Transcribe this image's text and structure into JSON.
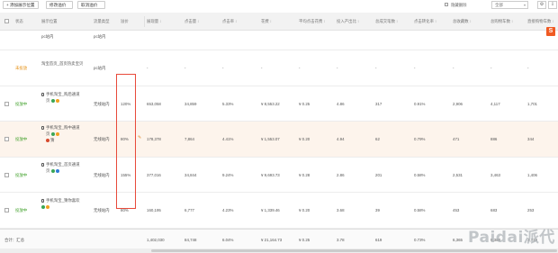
{
  "toolbar": {
    "add_label": "+ 添加展示位置",
    "bid_label": "修改溢价",
    "cancel_label": "取消溢价",
    "filter_label": "隐藏删除",
    "range_select": "全部",
    "gear_icon": "gear-icon",
    "download_icon": "download-icon"
  },
  "columns": [
    {
      "label": "状态",
      "sortable": false
    },
    {
      "label": "展示位置",
      "sortable": false
    },
    {
      "label": "流量类型",
      "sortable": false
    },
    {
      "label": "溢价",
      "sortable": false
    },
    {
      "label": "展现量",
      "sortable": true
    },
    {
      "label": "点击量",
      "sortable": true
    },
    {
      "label": "点击率",
      "sortable": true
    },
    {
      "label": "花费",
      "sortable": true
    },
    {
      "label": "平均点击花费",
      "sortable": true
    },
    {
      "label": "投入产出比",
      "sortable": true
    },
    {
      "label": "总成交笔数",
      "sortable": true
    },
    {
      "label": "点击转化率",
      "sortable": true
    },
    {
      "label": "总收藏数",
      "sortable": true
    },
    {
      "label": "总购物车数",
      "sortable": true
    },
    {
      "label": "直接购物车数",
      "sortable": true
    }
  ],
  "rows": [
    {
      "status": "",
      "position_lines": [
        "pc站内"
      ],
      "traffic": "pc站内",
      "premium": "",
      "metrics": [
        "",
        "",
        "",
        "",
        "",
        "",
        "",
        "",
        "",
        "",
        ""
      ]
    },
    {
      "status": "未投放",
      "position_lines": [
        "淘宝首页_首页热卖宝贝"
      ],
      "traffic": "pc站内",
      "premium": "",
      "metrics": [
        "-",
        "-",
        "-",
        "-",
        "-",
        "-",
        "-",
        "-",
        "-",
        "-",
        "-"
      ]
    },
    {
      "status": "投放中",
      "position_lines": [
        "手机淘宝_购后通道",
        "页"
      ],
      "traffic": "无线站内",
      "premium": "120%",
      "metrics": [
        "653,058",
        "34,859",
        "5.33%",
        "¥ 8,553.22",
        "¥ 0.25",
        "4.86",
        "317",
        "0.91%",
        "2,906",
        "4,117",
        "1,701"
      ]
    },
    {
      "status": "投放中",
      "position_lines": [
        "手机淘宝_购中通道",
        "页",
        "猜"
      ],
      "traffic": "无线站内",
      "premium": "80%",
      "metrics": [
        "178,378",
        "7,864",
        "4.41%",
        "¥ 1,553.07",
        "¥ 0.20",
        "4.94",
        "62",
        "0.79%",
        "471",
        "886",
        "344"
      ]
    },
    {
      "status": "投放中",
      "position_lines": [
        "手机淘宝_首页通道",
        "页"
      ],
      "traffic": "无线站内",
      "premium": "155%",
      "metrics": [
        "377,016",
        "34,844",
        "9.24%",
        "¥ 9,693.73",
        "¥ 0.28",
        "2.86",
        "201",
        "0.58%",
        "2,531",
        "3,463",
        "1,406"
      ]
    },
    {
      "status": "投放中",
      "position_lines": [
        "手机淘宝_猜你喜欢"
      ],
      "traffic": "无线站内",
      "premium": "80%",
      "metrics": [
        "160,195",
        "6,777",
        "4.23%",
        "¥ 1,339.46",
        "¥ 0.20",
        "3.68",
        "39",
        "0.58%",
        "453",
        "683",
        "253"
      ]
    }
  ],
  "total": {
    "label": "合计：汇总",
    "metrics": [
      "1,402,030",
      "84,748",
      "6.04%",
      "¥ 21,164.73",
      "¥ 0.25",
      "3.78",
      "619",
      "0.73%",
      "6,365",
      "9,388",
      "3,718"
    ]
  },
  "watermark": "Paidai派代",
  "logo_letter": "S",
  "colors": {
    "highlight_row": "#fdf4ec",
    "status_on": "#3a9d23",
    "status_wait": "#e58e0e",
    "annotation_box": "#e84a3a"
  }
}
